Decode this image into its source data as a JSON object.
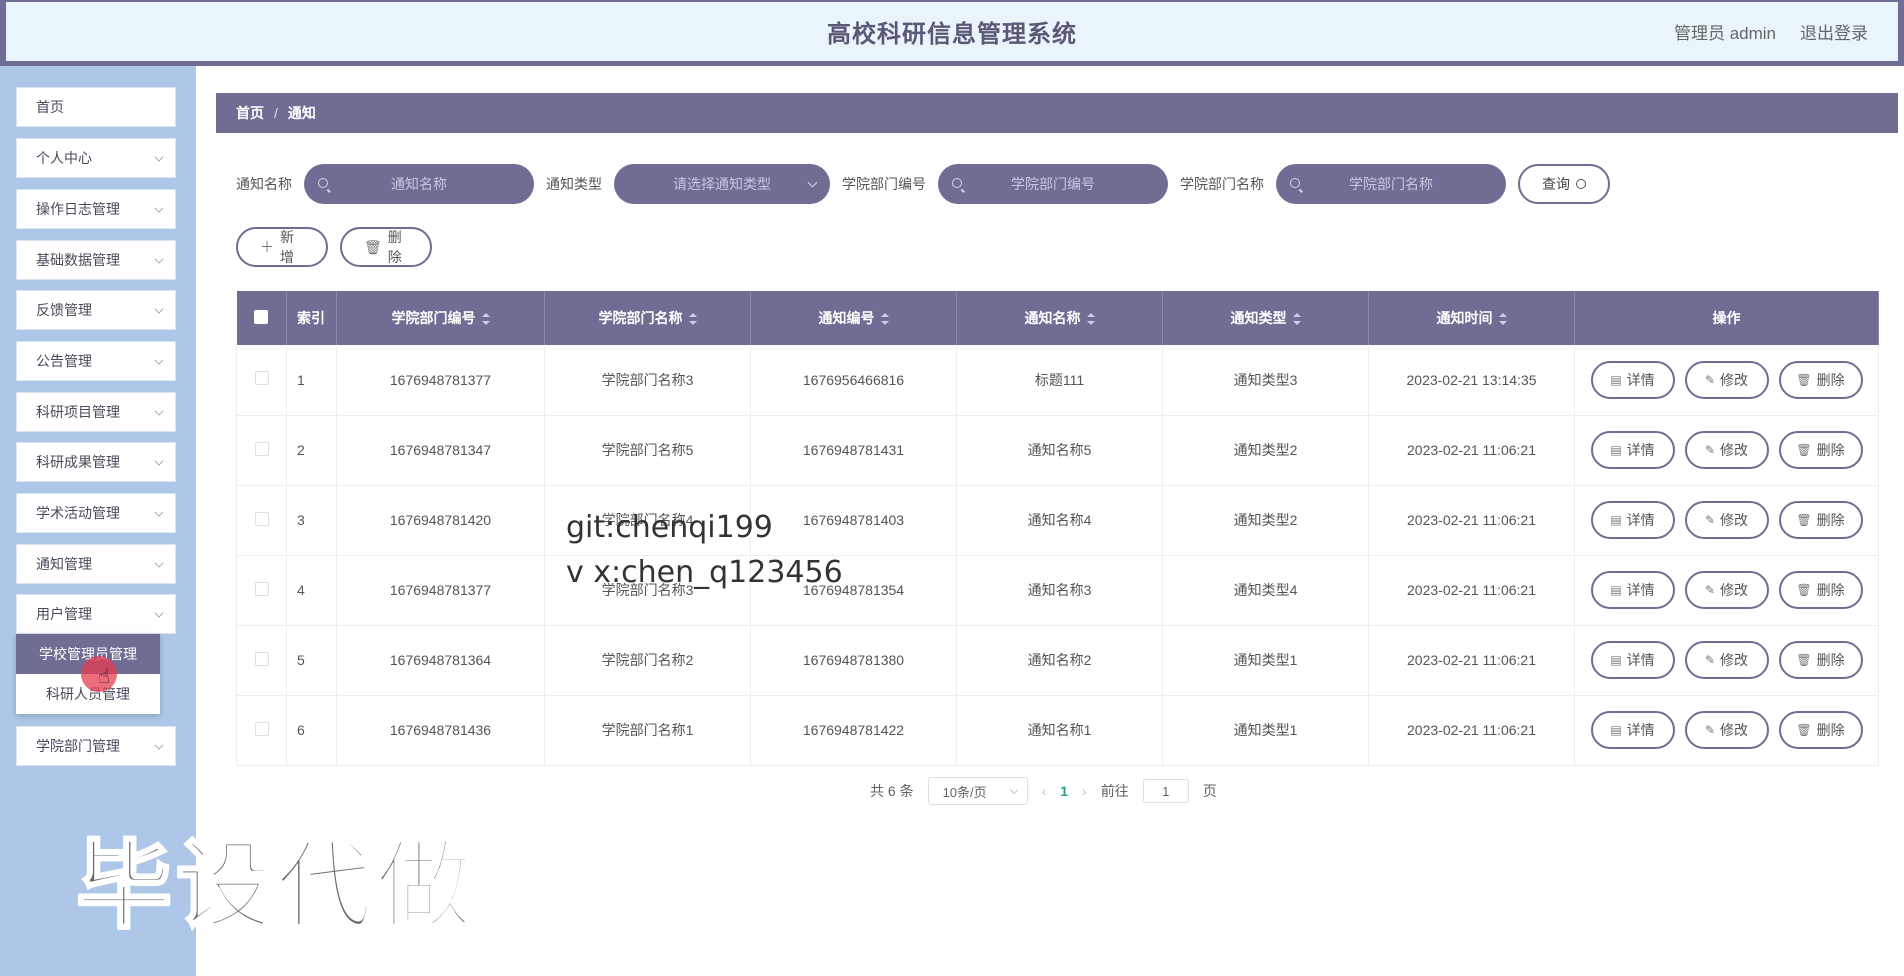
{
  "header": {
    "title": "高校科研信息管理系统",
    "user_label": "管理员 admin",
    "logout": "退出登录"
  },
  "sidebar": {
    "items": [
      {
        "label": "首页"
      },
      {
        "label": "个人中心"
      },
      {
        "label": "操作日志管理"
      },
      {
        "label": "基础数据管理"
      },
      {
        "label": "反馈管理"
      },
      {
        "label": "公告管理"
      },
      {
        "label": "科研项目管理"
      },
      {
        "label": "科研成果管理"
      },
      {
        "label": "学术活动管理"
      },
      {
        "label": "通知管理"
      },
      {
        "label": "用户管理"
      },
      {
        "label": "学院部门管理"
      }
    ],
    "submenu": [
      {
        "label": "学校管理员管理"
      },
      {
        "label": "科研人员管理"
      }
    ]
  },
  "breadcrumb": {
    "home": "首页",
    "sep": "/",
    "current": "通知"
  },
  "search": {
    "name_label": "通知名称",
    "name_placeholder": "通知名称",
    "type_label": "通知类型",
    "type_placeholder": "请选择通知类型",
    "dept_no_label": "学院部门编号",
    "dept_no_placeholder": "学院部门编号",
    "dept_name_label": "学院部门名称",
    "dept_name_placeholder": "学院部门名称",
    "query": "查询"
  },
  "actions": {
    "add": "新增",
    "delete": "删除"
  },
  "table": {
    "headers": [
      "索引",
      "学院部门编号",
      "学院部门名称",
      "通知编号",
      "通知名称",
      "通知类型",
      "通知时间",
      "操作"
    ],
    "rows": [
      {
        "idx": "1",
        "dept_no": "1676948781377",
        "dept_name": "学院部门名称3",
        "notice_no": "1676956466816",
        "name": "标题111",
        "type": "通知类型3",
        "time": "2023-02-21 13:14:35"
      },
      {
        "idx": "2",
        "dept_no": "1676948781347",
        "dept_name": "学院部门名称5",
        "notice_no": "1676948781431",
        "name": "通知名称5",
        "type": "通知类型2",
        "time": "2023-02-21 11:06:21"
      },
      {
        "idx": "3",
        "dept_no": "1676948781420",
        "dept_name": "学院部门名称4",
        "notice_no": "1676948781403",
        "name": "通知名称4",
        "type": "通知类型2",
        "time": "2023-02-21 11:06:21"
      },
      {
        "idx": "4",
        "dept_no": "1676948781377",
        "dept_name": "学院部门名称3",
        "notice_no": "1676948781354",
        "name": "通知名称3",
        "type": "通知类型4",
        "time": "2023-02-21 11:06:21"
      },
      {
        "idx": "5",
        "dept_no": "1676948781364",
        "dept_name": "学院部门名称2",
        "notice_no": "1676948781380",
        "name": "通知名称2",
        "type": "通知类型1",
        "time": "2023-02-21 11:06:21"
      },
      {
        "idx": "6",
        "dept_no": "1676948781436",
        "dept_name": "学院部门名称1",
        "notice_no": "1676948781422",
        "name": "通知名称1",
        "type": "通知类型1",
        "time": "2023-02-21 11:06:21"
      }
    ],
    "op_detail": "详情",
    "op_edit": "修改",
    "op_delete": "删除"
  },
  "pagination": {
    "total": "共 6 条",
    "page_size": "10条/页",
    "current_page": "1",
    "goto_label": "前往",
    "goto_value": "1",
    "page_suffix": "页"
  },
  "watermark": {
    "line1": "git:chenqi199",
    "line2": "v x:chen_q123456",
    "big": "毕设代做"
  },
  "colors": {
    "accent": "#6f6d93",
    "sidebar_bg": "#aec7e8",
    "header_bg": "#e9f4fb"
  }
}
